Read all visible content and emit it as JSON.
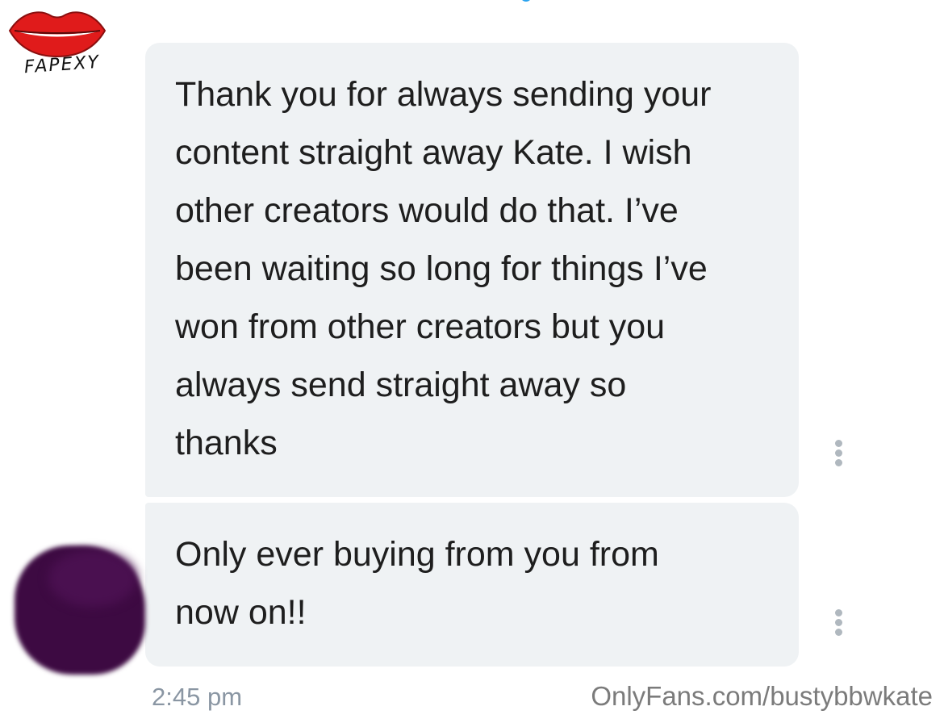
{
  "logo": {
    "text": "FAPEXY",
    "icon": "lips-icon",
    "color": "#e01b1b"
  },
  "messages": [
    {
      "text": "Thank you for always sending your\ncontent straight away Kate. I wish\nother creators would do that. I’ve\nbeen waiting so long for things I’ve\nwon from other creators but you\nalways send straight away so\nthanks"
    },
    {
      "text": "Only ever buying from you from\nnow on!!"
    }
  ],
  "timestamp": "2:45 pm",
  "watermark": "OnlyFans.com/bustybbwkate",
  "colors": {
    "bubble": "#eff2f4",
    "avatar": "#3d0a42",
    "timestamp": "#8a96a3",
    "top_indicator": "#2aa3ef"
  },
  "icons": {
    "message_menu": "more-vertical-icon"
  }
}
